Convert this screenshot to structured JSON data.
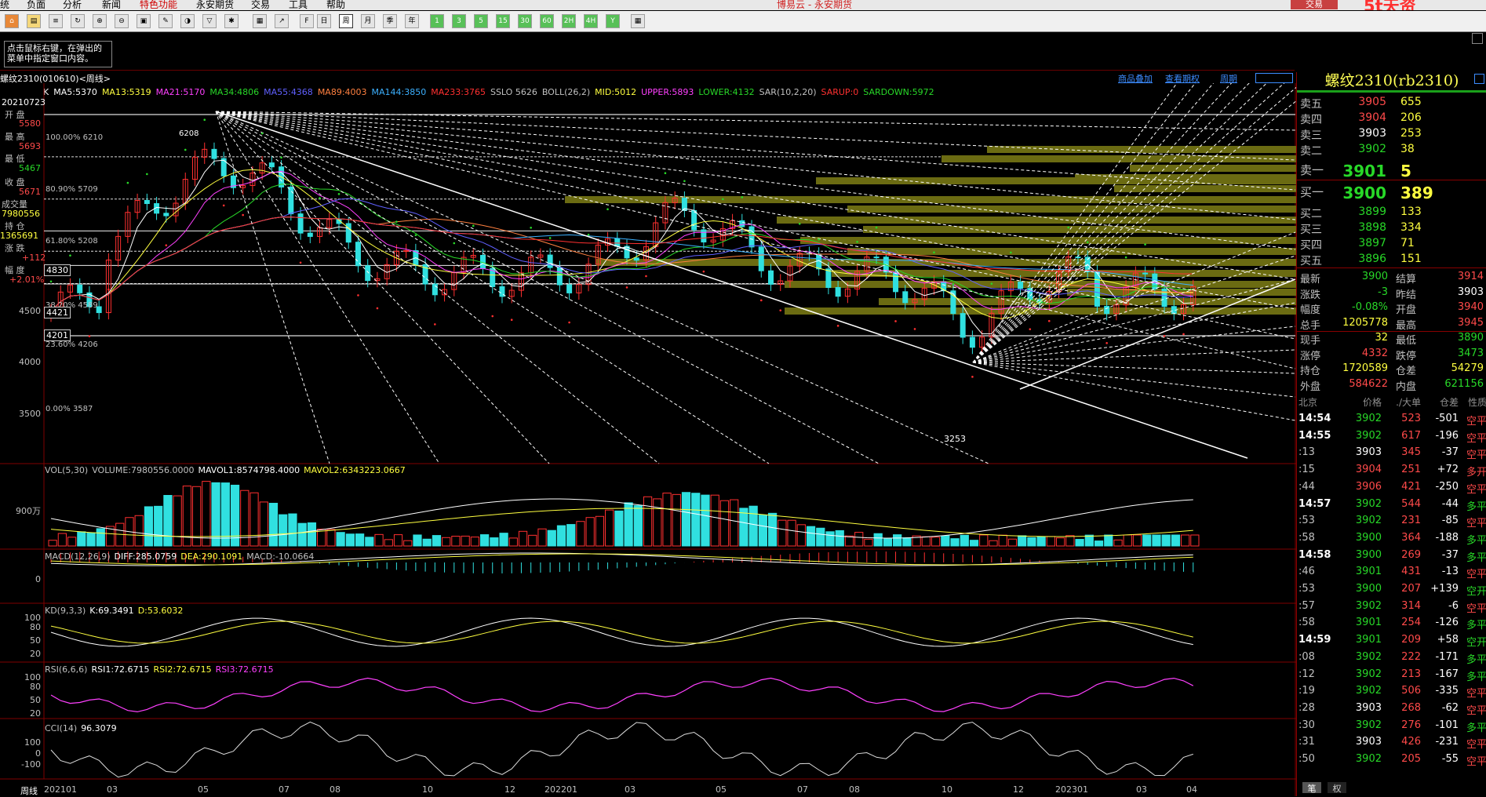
{
  "menu": {
    "items": [
      "统",
      "负面",
      "分析",
      "新闻",
      "特色功能",
      "永安期货",
      "交易",
      "工具",
      "帮助"
    ],
    "highlight_index": 4,
    "app_title": "博易云 - 永安期货",
    "trade_button": "交易",
    "watermark": "5t天资5etz.com"
  },
  "toolbar": {
    "period_buttons": [
      "日",
      "周",
      "月",
      "季",
      "年",
      "1",
      "3",
      "5",
      "15",
      "30",
      "60",
      "2H",
      "4H",
      "Y"
    ],
    "active_period": "周"
  },
  "hint": {
    "text": "点击鼠标右键，在弹出的菜单中指定窗口内容。"
  },
  "chart_header": {
    "title": "螺纹2310(010610)<周线>",
    "right_links": [
      "商品叠加",
      "查看期权",
      "周期"
    ]
  },
  "indicators": [
    {
      "text": "K",
      "color": "#ffffff"
    },
    {
      "text": "MA5:5370",
      "color": "#ffffff"
    },
    {
      "text": "MA13:5319",
      "color": "#ffff40"
    },
    {
      "text": "MA21:5170",
      "color": "#ff40ff"
    },
    {
      "text": "MA34:4806",
      "color": "#28d828"
    },
    {
      "text": "MA55:4368",
      "color": "#6060ff"
    },
    {
      "text": "MA89:4003",
      "color": "#ff8040"
    },
    {
      "text": "MA144:3850",
      "color": "#3cb0ff"
    },
    {
      "text": "MA233:3765",
      "color": "#ff3030"
    },
    {
      "text": "SSLO 5626",
      "color": "#c0c0c0"
    },
    {
      "text": "BOLL(26,2)",
      "color": "#c0c0c0"
    },
    {
      "text": "MID:5012",
      "color": "#ffff40"
    },
    {
      "text": "UPPER:5893",
      "color": "#ff40ff"
    },
    {
      "text": "LOWER:4132",
      "color": "#28d828"
    },
    {
      "text": "SAR(10,2,20)",
      "color": "#c0c0c0"
    },
    {
      "text": "SARUP:0",
      "color": "#ff3030"
    },
    {
      "text": "SARDOWN:5972",
      "color": "#28d828"
    }
  ],
  "left_panel": {
    "date": "20210723",
    "open_label": "开 盘",
    "open": "5580",
    "high_label": "最 高",
    "high": "5693",
    "low_label": "最 低",
    "low": "5467",
    "close_label": "收 盘",
    "close": "5671",
    "volume_label": "成交量",
    "volume": "7980556",
    "oi_label": "持 仓",
    "oi": "1365691",
    "change_label": "涨 跌",
    "change": "+112",
    "pct_label": "幅 度",
    "pct": "+2.01%"
  },
  "price_axis": [
    "4500",
    "4000",
    "3500"
  ],
  "price_boxes": [
    "4830",
    "4421",
    "4201"
  ],
  "fib_labels": [
    "100.00% 6210",
    "80.90% 5709",
    "61.80% 5208",
    "38.20% 4589",
    "23.60% 4206",
    "0.00% 3587"
  ],
  "extreme_labels": {
    "high": "6208",
    "low": "3253"
  },
  "volume": {
    "header": [
      "VOL(5,30)",
      "VOLUME:7980556.0000",
      "MAVOL1:8574798.4000",
      "MAVOL2:6343223.0667"
    ],
    "axis": "900万"
  },
  "macd": {
    "header": [
      "MACD(12,26,9)",
      "DIFF:285.0759",
      "DEA:290.1091",
      "MACD:-10.0664"
    ],
    "axis": "0"
  },
  "kd": {
    "header": [
      "KD(9,3,3)",
      "K:69.3491",
      "D:53.6032"
    ],
    "axis": [
      "100",
      "80",
      "50",
      "20"
    ]
  },
  "rsi": {
    "header": [
      "RSI(6,6,6)",
      "RSI1:72.6715",
      "RSI2:72.6715",
      "RSI3:72.6715"
    ],
    "axis": [
      "100",
      "80",
      "50",
      "20"
    ]
  },
  "cci": {
    "header": [
      "CCI(14)",
      "96.3079"
    ],
    "axis": [
      "100",
      "0",
      "-100"
    ]
  },
  "x_axis": [
    "周线",
    "202101",
    "03",
    "05",
    "07",
    "08",
    "10",
    "12",
    "202201",
    "03",
    "05",
    "07",
    "08",
    "10",
    "12",
    "202301",
    "03",
    "04"
  ],
  "quote": {
    "title": "螺纹2310(rb2310)",
    "asks": [
      {
        "label": "卖五",
        "price": "3905",
        "vol": "655"
      },
      {
        "label": "卖四",
        "price": "3904",
        "vol": "206"
      },
      {
        "label": "卖三",
        "price": "3903",
        "vol": "253"
      },
      {
        "label": "卖二",
        "price": "3902",
        "vol": "38"
      },
      {
        "label": "卖一",
        "price": "3901",
        "vol": "5"
      }
    ],
    "bids": [
      {
        "label": "买一",
        "price": "3900",
        "vol": "389"
      },
      {
        "label": "买二",
        "price": "3899",
        "vol": "133"
      },
      {
        "label": "买三",
        "price": "3898",
        "vol": "334"
      },
      {
        "label": "买四",
        "price": "3897",
        "vol": "71"
      },
      {
        "label": "买五",
        "price": "3896",
        "vol": "151"
      }
    ],
    "stats": [
      {
        "k1": "最新",
        "v1": "3900",
        "c1": "grn",
        "k2": "结算",
        "v2": "3914",
        "c2": "red"
      },
      {
        "k1": "涨跌",
        "v1": "-3",
        "c1": "grn",
        "k2": "昨结",
        "v2": "3903",
        "c2": "wht"
      },
      {
        "k1": "幅度",
        "v1": "-0.08%",
        "c1": "grn",
        "k2": "开盘",
        "v2": "3940",
        "c2": "red"
      },
      {
        "k1": "总手",
        "v1": "1205778",
        "c1": "yel",
        "k2": "最高",
        "v2": "3945",
        "c2": "red"
      },
      {
        "k1": "现手",
        "v1": "32",
        "c1": "yel",
        "k2": "最低",
        "v2": "3890",
        "c2": "grn"
      },
      {
        "k1": "涨停",
        "v1": "4332",
        "c1": "red",
        "k2": "跌停",
        "v2": "3473",
        "c2": "grn"
      },
      {
        "k1": "持仓",
        "v1": "1720589",
        "c1": "yel",
        "k2": "仓差",
        "v2": "54279",
        "c2": "yel"
      },
      {
        "k1": "外盘",
        "v1": "584622",
        "c1": "red",
        "k2": "内盘",
        "v2": "621156",
        "c2": "grn"
      }
    ],
    "tick_header": {
      "loc": "北京",
      "price": "价格",
      "qty": "./大单",
      "diff": "仓差",
      "nature": "性质"
    },
    "ticks": [
      {
        "t": "14:54",
        "b": true,
        "p": "3902",
        "pc": "grn",
        "q": "523",
        "d": "-501",
        "n": "空平",
        "nc": "red"
      },
      {
        "t": "14:55",
        "b": true,
        "p": "3902",
        "pc": "grn",
        "q": "617",
        "d": "-196",
        "n": "空平",
        "nc": "red"
      },
      {
        "t": ":13",
        "b": false,
        "p": "3903",
        "pc": "wht",
        "q": "345",
        "d": "-37",
        "n": "空平",
        "nc": "red"
      },
      {
        "t": ":15",
        "b": false,
        "p": "3904",
        "pc": "red",
        "q": "251",
        "d": "+72",
        "n": "多开",
        "nc": "red"
      },
      {
        "t": ":44",
        "b": false,
        "p": "3906",
        "pc": "red",
        "q": "421",
        "d": "-250",
        "n": "空平",
        "nc": "red"
      },
      {
        "t": "14:57",
        "b": true,
        "p": "3902",
        "pc": "grn",
        "q": "544",
        "d": "-44",
        "n": "多平",
        "nc": "grn"
      },
      {
        "t": ":53",
        "b": false,
        "p": "3902",
        "pc": "grn",
        "q": "231",
        "d": "-85",
        "n": "空平",
        "nc": "red"
      },
      {
        "t": ":58",
        "b": false,
        "p": "3900",
        "pc": "grn",
        "q": "364",
        "d": "-188",
        "n": "多平",
        "nc": "grn"
      },
      {
        "t": "14:58",
        "b": true,
        "p": "3900",
        "pc": "grn",
        "q": "269",
        "d": "-37",
        "n": "多平",
        "nc": "grn"
      },
      {
        "t": ":46",
        "b": false,
        "p": "3901",
        "pc": "grn",
        "q": "431",
        "d": "-13",
        "n": "空平",
        "nc": "red"
      },
      {
        "t": ":53",
        "b": false,
        "p": "3900",
        "pc": "grn",
        "q": "207",
        "d": "+139",
        "n": "空开",
        "nc": "grn"
      },
      {
        "t": ":57",
        "b": false,
        "p": "3902",
        "pc": "grn",
        "q": "314",
        "d": "-6",
        "n": "空平",
        "nc": "red"
      },
      {
        "t": ":58",
        "b": false,
        "p": "3901",
        "pc": "grn",
        "q": "254",
        "d": "-126",
        "n": "多平",
        "nc": "grn"
      },
      {
        "t": "14:59",
        "b": true,
        "p": "3901",
        "pc": "grn",
        "q": "209",
        "d": "+58",
        "n": "空开",
        "nc": "grn"
      },
      {
        "t": ":08",
        "b": false,
        "p": "3902",
        "pc": "grn",
        "q": "222",
        "d": "-171",
        "n": "多平",
        "nc": "grn"
      },
      {
        "t": ":12",
        "b": false,
        "p": "3902",
        "pc": "grn",
        "q": "213",
        "d": "-167",
        "n": "多平",
        "nc": "grn"
      },
      {
        "t": ":19",
        "b": false,
        "p": "3902",
        "pc": "grn",
        "q": "506",
        "d": "-335",
        "n": "空平",
        "nc": "red"
      },
      {
        "t": ":28",
        "b": false,
        "p": "3903",
        "pc": "wht",
        "q": "268",
        "d": "-62",
        "n": "空平",
        "nc": "red"
      },
      {
        "t": ":30",
        "b": false,
        "p": "3902",
        "pc": "grn",
        "q": "276",
        "d": "-101",
        "n": "多平",
        "nc": "grn"
      },
      {
        "t": ":31",
        "b": false,
        "p": "3903",
        "pc": "wht",
        "q": "426",
        "d": "-231",
        "n": "空平",
        "nc": "red"
      },
      {
        "t": ":50",
        "b": false,
        "p": "3902",
        "pc": "grn",
        "q": "205",
        "d": "-55",
        "n": "空平",
        "nc": "red"
      }
    ],
    "bottom_tabs": [
      "笔",
      "权"
    ]
  }
}
